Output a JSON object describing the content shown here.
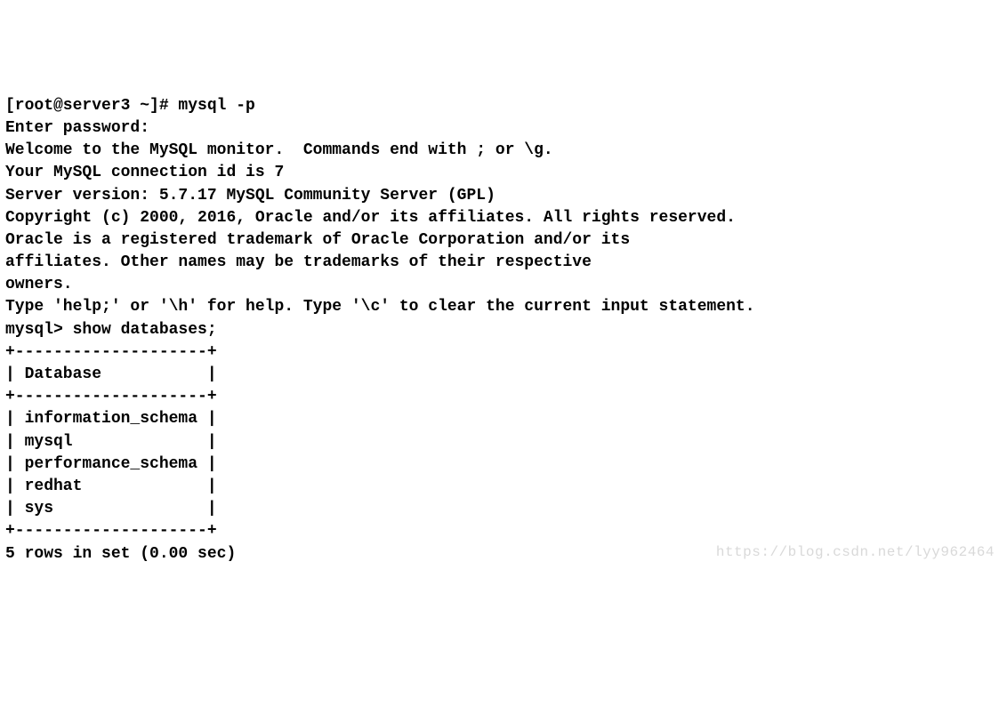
{
  "terminal": {
    "lines": {
      "l0": "[root@server3 ~]# mysql -p",
      "l1": "Enter password:",
      "l2": "Welcome to the MySQL monitor.  Commands end with ; or \\g.",
      "l3": "Your MySQL connection id is 7",
      "l4": "Server version: 5.7.17 MySQL Community Server (GPL)",
      "l5": "",
      "l6": "Copyright (c) 2000, 2016, Oracle and/or its affiliates. All rights reserved.",
      "l7": "",
      "l8": "Oracle is a registered trademark of Oracle Corporation and/or its",
      "l9": "affiliates. Other names may be trademarks of their respective",
      "l10": "owners.",
      "l11": "",
      "l12": "Type 'help;' or '\\h' for help. Type '\\c' to clear the current input statement.",
      "l13": "",
      "l14": "mysql> show databases;",
      "l15": "+--------------------+",
      "l16": "| Database           |",
      "l17": "+--------------------+",
      "l18": "| information_schema |",
      "l19": "| mysql              |",
      "l20": "| performance_schema |",
      "l21": "| redhat             |",
      "l22": "| sys                |",
      "l23": "+--------------------+",
      "l24": "5 rows in set (0.00 sec)"
    }
  },
  "watermark": {
    "text": "https://blog.csdn.net/lyy962464"
  }
}
